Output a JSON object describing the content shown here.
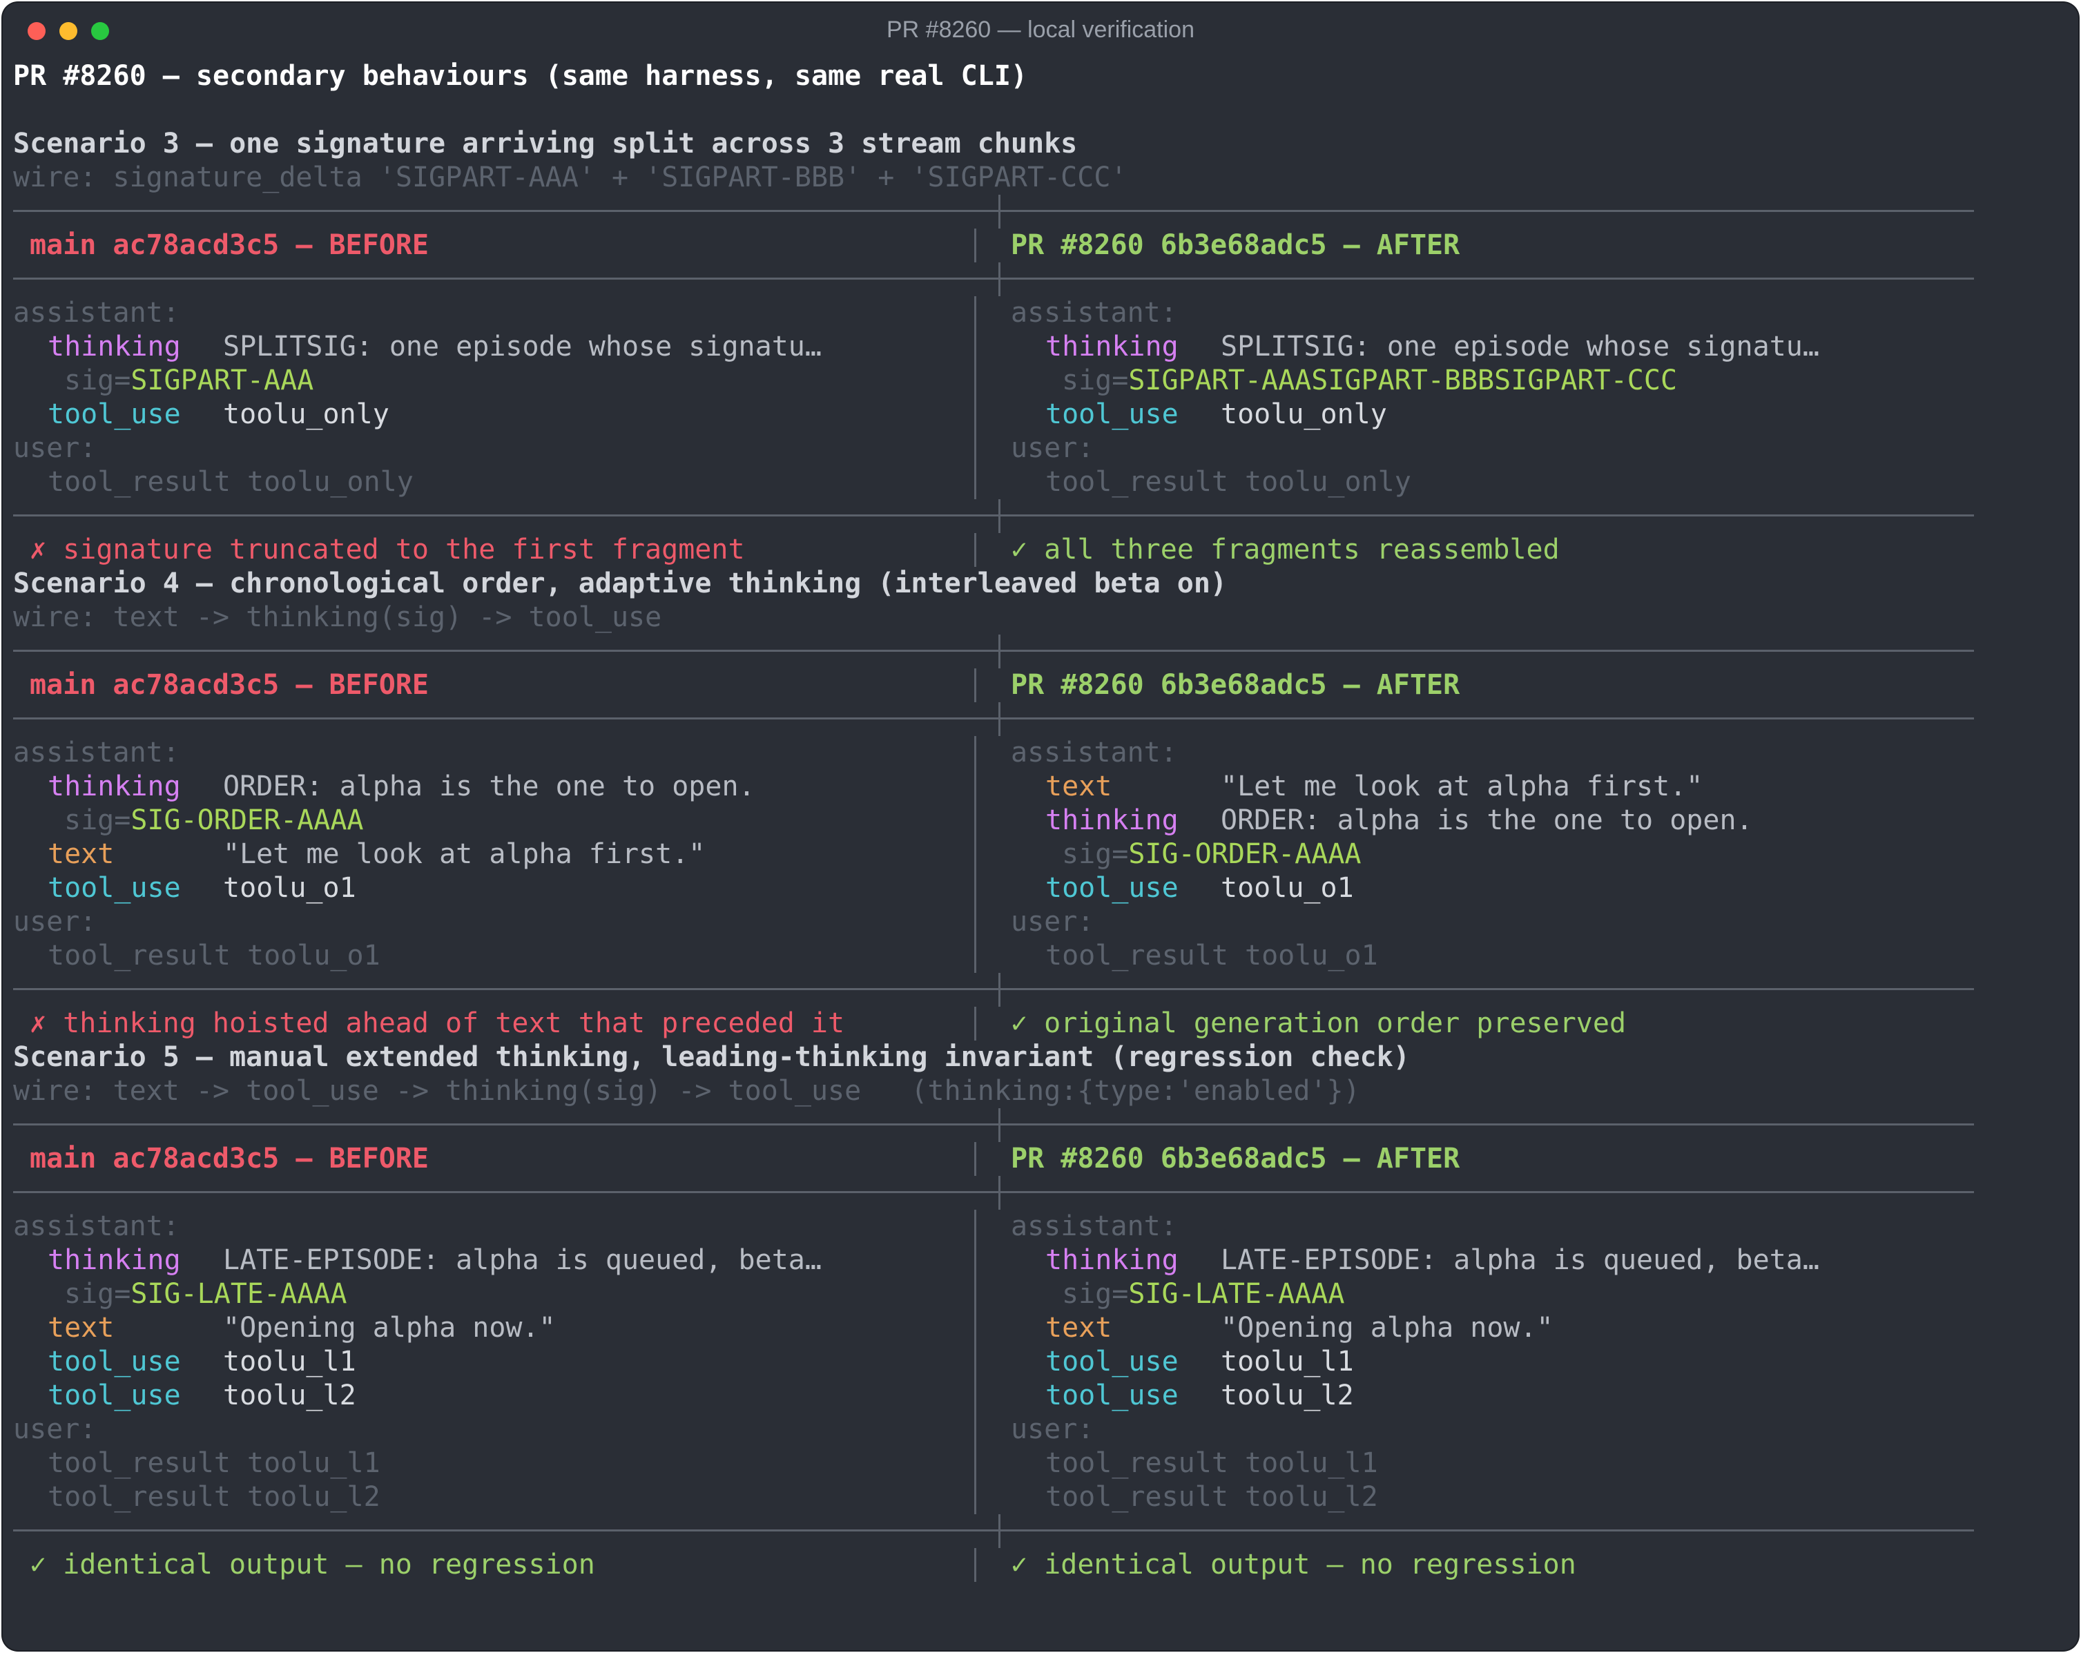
{
  "window": {
    "title": "PR #8260 — local verification"
  },
  "page_title": "PR #8260 — secondary behaviours (same harness, same real CLI)",
  "headers": {
    "before": "main ac78acd3c5 — BEFORE",
    "after": "PR #8260 6b3e68adc5 — AFTER"
  },
  "labels": {
    "assistant": "assistant:",
    "user": "user:",
    "thinking": "thinking",
    "tool_use": "tool_use",
    "text": "text",
    "sig": "sig=",
    "tool_result": "tool_result"
  },
  "scenarios": [
    {
      "title": "Scenario 3 — one signature arriving split across 3 stream chunks",
      "wire": "wire: signature_delta 'SIGPART-AAA' + 'SIGPART-BBB' + 'SIGPART-CCC'",
      "before": {
        "thinking": "SPLITSIG: one episode whose signatu…",
        "sig": "SIGPART-AAA",
        "tool_use": "toolu_only",
        "tool_result": "toolu_only",
        "verdict": "✗ signature truncated to the first fragment"
      },
      "after": {
        "thinking": "SPLITSIG: one episode whose signatu…",
        "sig": "SIGPART-AAASIGPART-BBBSIGPART-CCC",
        "tool_use": "toolu_only",
        "tool_result": "toolu_only",
        "verdict": "✓ all three fragments reassembled"
      }
    },
    {
      "title": "Scenario 4 — chronological order, adaptive thinking (interleaved beta on)",
      "wire": "wire: text -> thinking(sig) -> tool_use",
      "before": {
        "thinking": "ORDER: alpha is the one to open.",
        "sig": "SIG-ORDER-AAAA",
        "text": "\"Let me look at alpha first.\"",
        "tool_use": "toolu_o1",
        "tool_result": "toolu_o1",
        "verdict": "✗ thinking hoisted ahead of text that preceded it"
      },
      "after": {
        "text": "\"Let me look at alpha first.\"",
        "thinking": "ORDER: alpha is the one to open.",
        "sig": "SIG-ORDER-AAAA",
        "tool_use": "toolu_o1",
        "tool_result": "toolu_o1",
        "verdict": "✓ original generation order preserved"
      }
    },
    {
      "title": "Scenario 5 — manual extended thinking, leading-thinking invariant (regression check)",
      "wire": "wire: text -> tool_use -> thinking(sig) -> tool_use   (thinking:{type:'enabled'})",
      "before": {
        "thinking": "LATE-EPISODE: alpha is queued, beta…",
        "sig": "SIG-LATE-AAAA",
        "text": "\"Opening alpha now.\"",
        "tool_use_1": "toolu_l1",
        "tool_use_2": "toolu_l2",
        "tool_result_1": "toolu_l1",
        "tool_result_2": "toolu_l2",
        "verdict": "✓ identical output — no regression"
      },
      "after": {
        "thinking": "LATE-EPISODE: alpha is queued, beta…",
        "sig": "SIG-LATE-AAAA",
        "text": "\"Opening alpha now.\"",
        "tool_use_1": "toolu_l1",
        "tool_use_2": "toolu_l2",
        "tool_result_1": "toolu_l1",
        "tool_result_2": "toolu_l2",
        "verdict": "✓ identical output — no regression"
      }
    }
  ],
  "colors": {
    "background": "#2a2e36",
    "before": "#ee5a6a",
    "after": "#9cd06a",
    "thinking": "#d680f2",
    "tool_use": "#4fc7d4",
    "text": "#e8a05a",
    "signature": "#a9d85a"
  }
}
